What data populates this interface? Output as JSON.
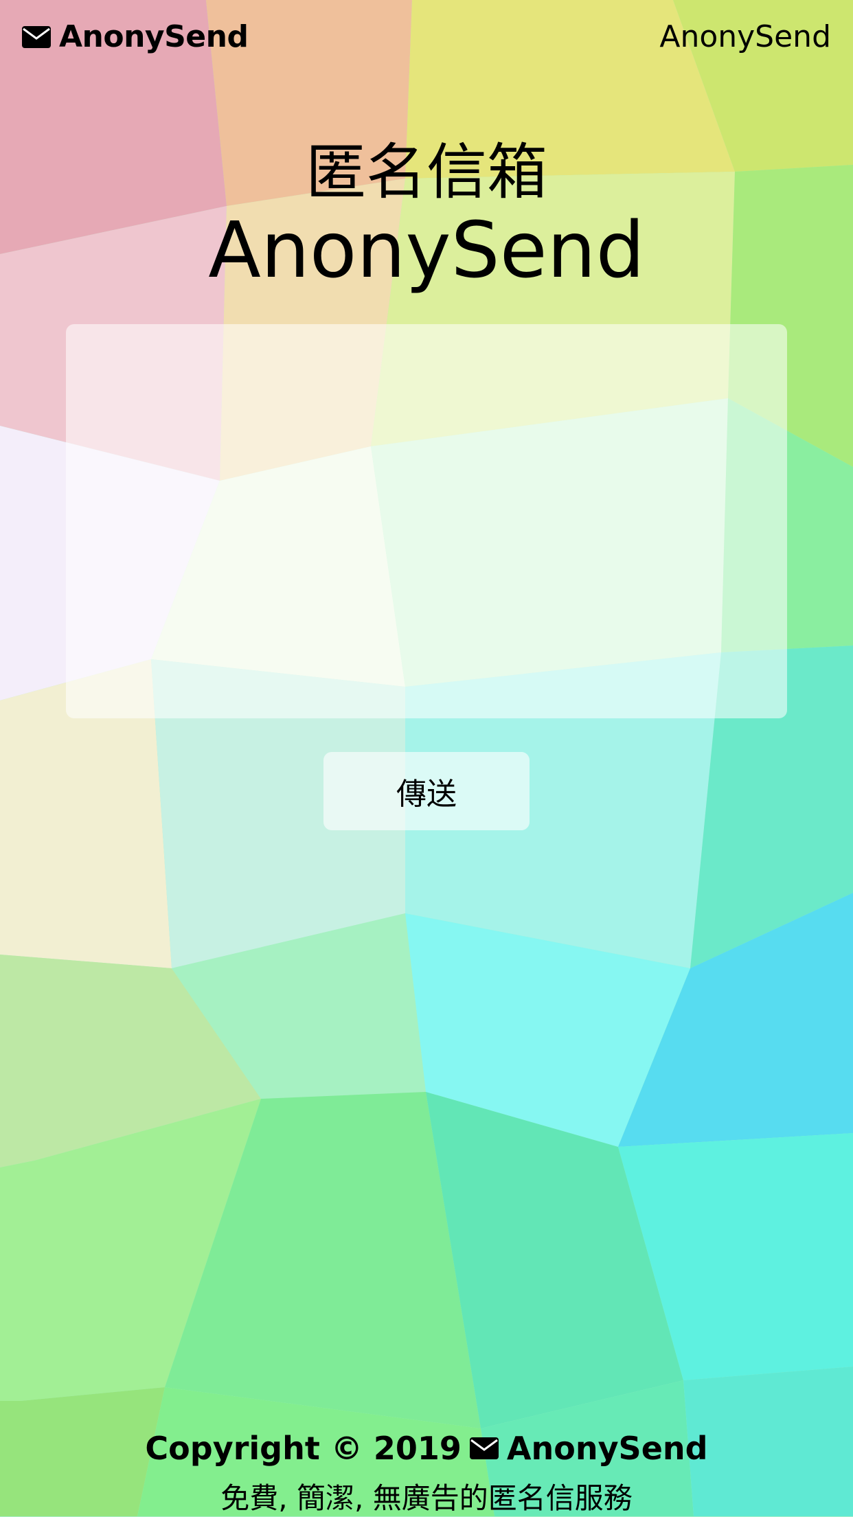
{
  "header": {
    "brand_label": "AnonySend",
    "nav_link": "AnonySend"
  },
  "main": {
    "title_zh": "匿名信箱",
    "title_en": "AnonySend",
    "message_value": "",
    "send_label": "傳送"
  },
  "footer": {
    "copyright_prefix": "Copyright © 2019",
    "copyright_brand": "AnonySend",
    "tagline": "免費, 簡潔, 無廣告的匿名信服務"
  },
  "icons": {
    "brand": "envelope-icon",
    "footer": "envelope-icon"
  }
}
